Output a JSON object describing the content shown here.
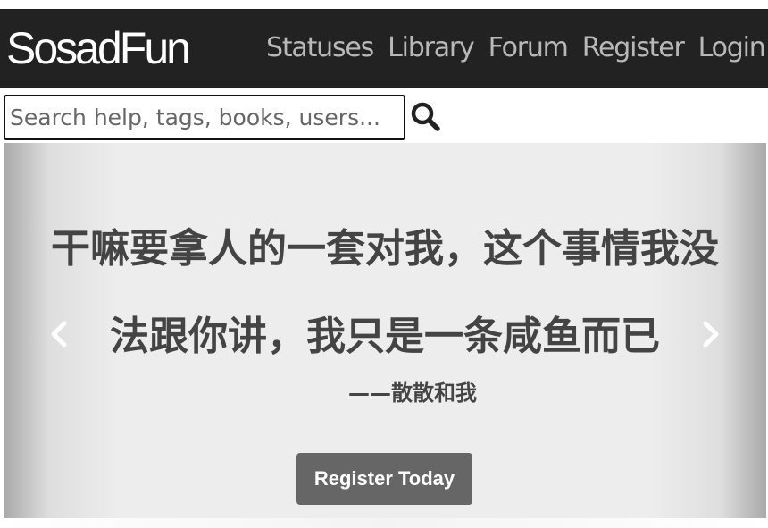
{
  "navbar": {
    "brand": "SosadFun",
    "links": [
      {
        "label": "Statuses"
      },
      {
        "label": "Library"
      },
      {
        "label": "Forum"
      },
      {
        "label": "Register"
      },
      {
        "label": "Login"
      }
    ],
    "background": "#222222",
    "link_color": "#b8b8b8"
  },
  "search": {
    "placeholder": "Search help, tags, books, users...",
    "value": "",
    "button_icon": "search-icon"
  },
  "carousel": {
    "quote_lines": [
      "干嘛要拿人的一套对我，这个事情我没",
      "法跟你讲，我只是一条咸鱼而已"
    ],
    "attribution": "——散散和我",
    "prev_icon": "chevron-left-icon",
    "next_icon": "chevron-right-icon",
    "cta_label": "Register Today",
    "cta_color": "#666666",
    "text_color": "#444444"
  }
}
